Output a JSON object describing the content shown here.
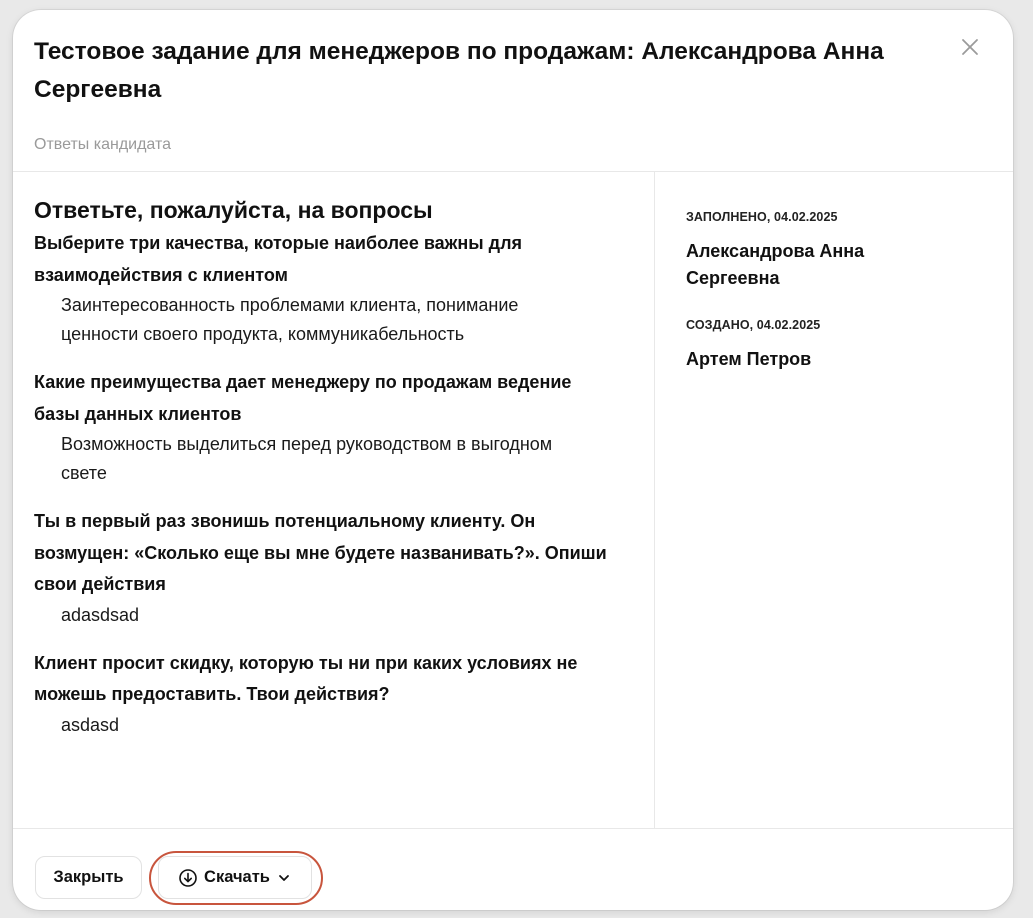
{
  "modal": {
    "title": "Тестовое задание для менеджеров по продажам: Александрова Анна Сергеевна",
    "subtitle": "Ответы кандидата"
  },
  "answers": {
    "heading": "Ответьте, пожалуйста, на вопросы",
    "items": [
      {
        "question": "Выберите три качества, которые наиболее важны для взаимодействия с клиентом",
        "answer": "Заинтересованность проблемами клиента, понимание ценности своего продукта, коммуникабельность"
      },
      {
        "question": "Какие преимущества дает менеджеру по продажам ведение базы данных клиентов",
        "answer": "Возможность выделиться перед руководством в выгодном свете"
      },
      {
        "question": "Ты в первый раз звонишь потенциальному клиенту. Он возмущен: «Сколько еще вы мне будете названивать?». Опиши свои действия",
        "answer": "adasdsad"
      },
      {
        "question": "Клиент просит скидку, которую ты ни при каких условиях не можешь предоставить. Твои действия?",
        "answer": "asdasd"
      }
    ]
  },
  "meta": {
    "filled_label": "ЗАПОЛНЕНО, 04.02.2025",
    "filled_by": "Александрова Анна Сергеевна",
    "created_label": "СОЗДАНО, 04.02.2025",
    "created_by": "Артем Петров"
  },
  "footer": {
    "close_label": "Закрыть",
    "download_label": "Скачать"
  },
  "icons": {
    "close": "close-icon",
    "download": "download-icon",
    "chevron": "chevron-down-icon"
  },
  "colors": {
    "highlight": "#c8553d",
    "subtitle": "#9a9a9a",
    "divider": "#e8e8e8"
  }
}
